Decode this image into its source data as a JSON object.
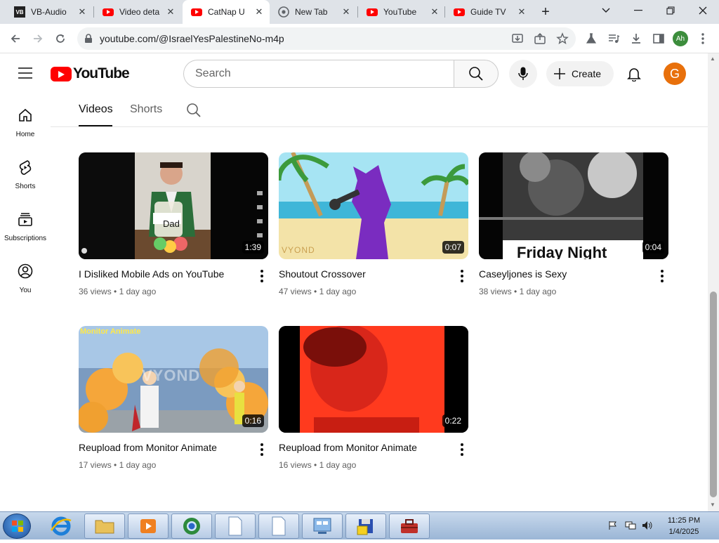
{
  "browser": {
    "tabs": [
      {
        "label": "VB-Audio",
        "icon": "vb-audio-icon",
        "active": false
      },
      {
        "label": "Video deta",
        "icon": "youtube-icon",
        "active": false
      },
      {
        "label": "CatNap U",
        "icon": "youtube-icon",
        "active": true
      },
      {
        "label": "New Tab",
        "icon": "chrome-icon",
        "active": false
      },
      {
        "label": "YouTube",
        "icon": "youtube-icon",
        "active": false
      },
      {
        "label": "Guide TV",
        "icon": "youtube-icon",
        "active": false
      }
    ],
    "url": "youtube.com/@IsraelYesPalestineNo-m4p",
    "profile_initials": "Ah"
  },
  "header": {
    "logo_text": "YouTube",
    "search_placeholder": "Search",
    "create_label": "Create",
    "avatar_letter": "G"
  },
  "sidebar": {
    "items": [
      {
        "label": "Home",
        "icon": "home-icon"
      },
      {
        "label": "Shorts",
        "icon": "shorts-icon"
      },
      {
        "label": "Subscriptions",
        "icon": "subscriptions-icon"
      },
      {
        "label": "You",
        "icon": "you-icon"
      }
    ]
  },
  "channel_tabs": [
    {
      "label": "Videos",
      "active": true
    },
    {
      "label": "Shorts",
      "active": false
    }
  ],
  "videos": [
    {
      "title": "I Disliked Mobile Ads on YouTube",
      "views": "36 views",
      "age": "1 day ago",
      "duration": "1:39"
    },
    {
      "title": "Shoutout Crossover",
      "views": "47 views",
      "age": "1 day ago",
      "duration": "0:07"
    },
    {
      "title": "Caseyljones is Sexy",
      "views": "38 views",
      "age": "1 day ago",
      "duration": "0:04"
    },
    {
      "title": "Reupload from Monitor Animate",
      "views": "17 views",
      "age": "1 day ago",
      "duration": "0:16"
    },
    {
      "title": "Reupload from Monitor Animate",
      "views": "16 views",
      "age": "1 day ago",
      "duration": "0:22"
    }
  ],
  "thumb_text": {
    "dad": "Dad",
    "vyond": "VYOND",
    "friday": "Friday Night",
    "monitor": "Monitor Animate"
  },
  "taskbar": {
    "time": "11:25 PM",
    "date": "1/4/2025"
  },
  "colors": {
    "yt_red": "#ff0000",
    "avatar_bg": "#e8700b"
  }
}
